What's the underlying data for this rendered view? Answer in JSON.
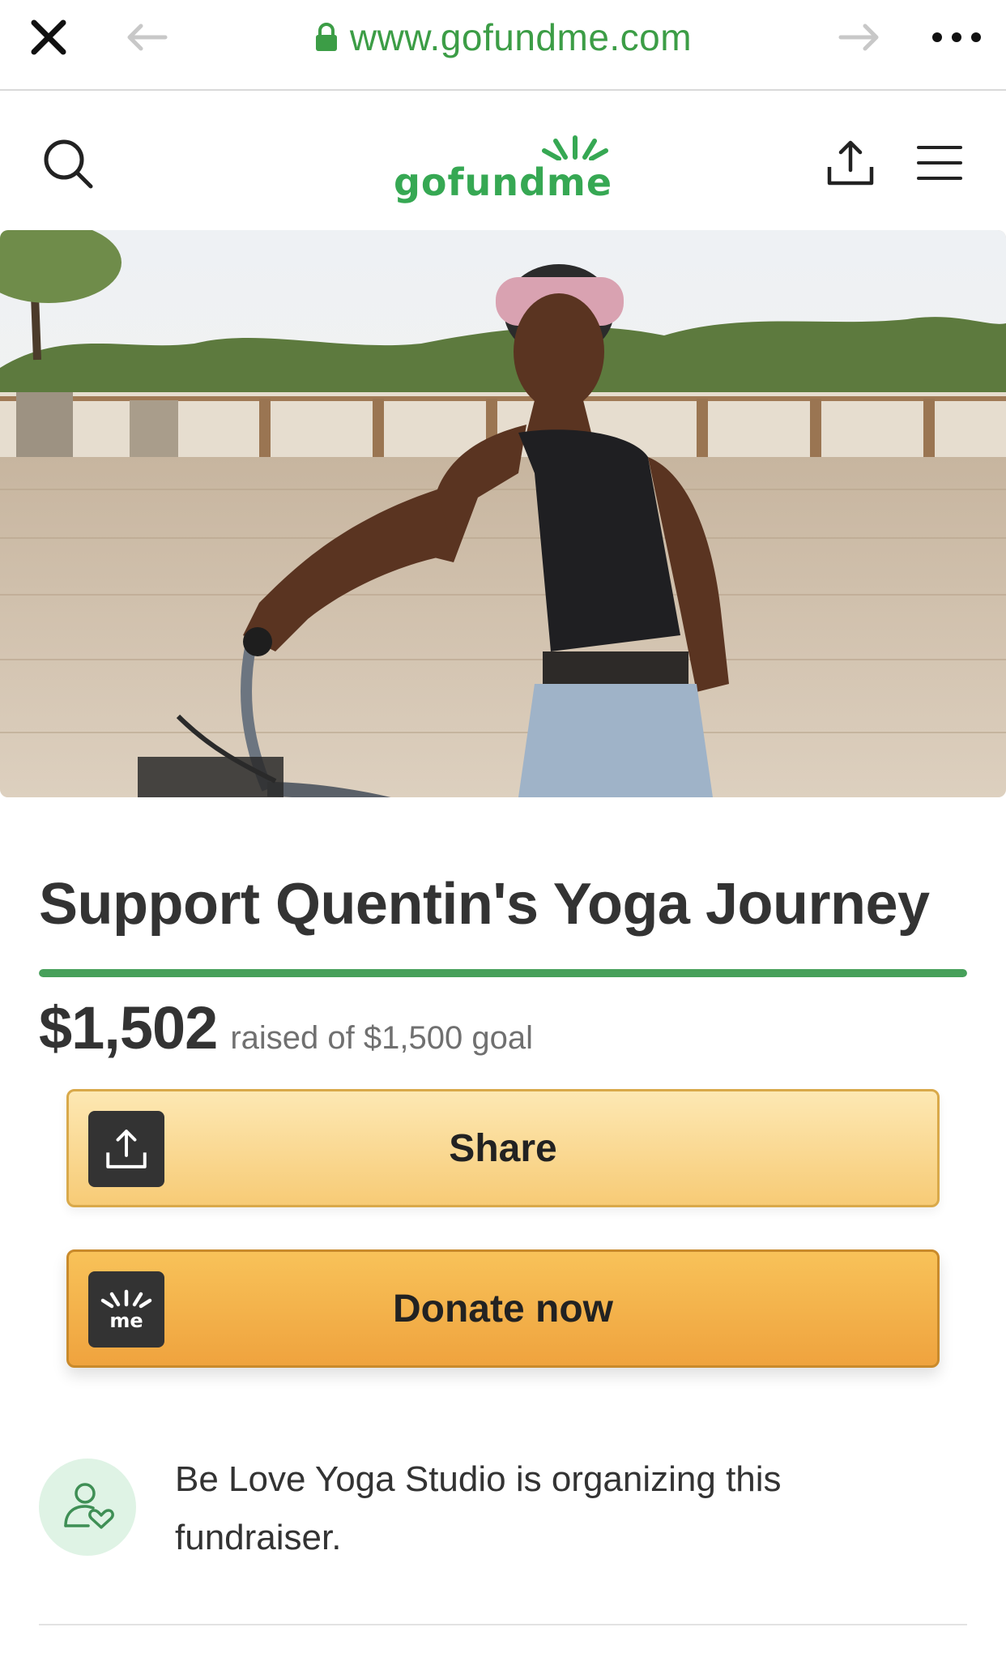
{
  "browser": {
    "url": "www.gofundme.com",
    "icons": {
      "close": "close-icon",
      "back": "back-arrow-icon",
      "forward": "forward-arrow-icon",
      "more": "more-icon",
      "lock": "lock-icon"
    }
  },
  "header": {
    "logo": "gofundme",
    "icons": {
      "search": "search-icon",
      "share": "share-icon",
      "menu": "menu-icon"
    }
  },
  "campaign": {
    "title": "Support Quentin's Yoga Journey",
    "amount": "$1,502",
    "goal_text": "raised of $1,500 goal",
    "progress_fraction": 1.0
  },
  "actions": {
    "share_label": "Share",
    "donate_label": "Donate now"
  },
  "organizer": {
    "text": "Be Love Yoga Studio is organizing this fundraiser."
  },
  "colors": {
    "brand_green": "#36a853",
    "progress_green": "#46a05a",
    "share_button": "#f7cb76",
    "donate_button": "#efa33e"
  }
}
